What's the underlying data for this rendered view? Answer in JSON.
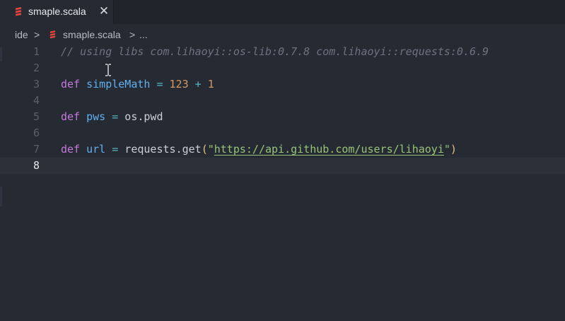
{
  "tab": {
    "title": "smaple.scala",
    "close_glyph": "✕",
    "icon": "scala-icon"
  },
  "breadcrumb": {
    "folder": "ide",
    "separator": ">",
    "file": "smaple.scala",
    "more": "..."
  },
  "editor": {
    "active_line": 8,
    "lines": [
      {
        "number": "1",
        "tokens": [
          {
            "t": "// using libs com.lihaoyi::os-lib:0.7.8 com.lihaoyi::requests:0.6.9",
            "c": "cm"
          }
        ]
      },
      {
        "number": "2",
        "tokens": []
      },
      {
        "number": "3",
        "tokens": [
          {
            "t": "def",
            "c": "kw"
          },
          {
            "t": " ",
            "c": "txt"
          },
          {
            "t": "simpleMath",
            "c": "fn"
          },
          {
            "t": " ",
            "c": "txt"
          },
          {
            "t": "=",
            "c": "op"
          },
          {
            "t": " ",
            "c": "txt"
          },
          {
            "t": "123",
            "c": "num"
          },
          {
            "t": " ",
            "c": "txt"
          },
          {
            "t": "+",
            "c": "op"
          },
          {
            "t": " ",
            "c": "txt"
          },
          {
            "t": "1",
            "c": "num"
          }
        ]
      },
      {
        "number": "4",
        "tokens": []
      },
      {
        "number": "5",
        "tokens": [
          {
            "t": "def",
            "c": "kw"
          },
          {
            "t": " ",
            "c": "txt"
          },
          {
            "t": "pws",
            "c": "fn"
          },
          {
            "t": " ",
            "c": "txt"
          },
          {
            "t": "=",
            "c": "op"
          },
          {
            "t": " os.pwd",
            "c": "txt"
          }
        ]
      },
      {
        "number": "6",
        "tokens": []
      },
      {
        "number": "7",
        "tokens": [
          {
            "t": "def",
            "c": "kw"
          },
          {
            "t": " ",
            "c": "txt"
          },
          {
            "t": "url",
            "c": "fn"
          },
          {
            "t": " ",
            "c": "txt"
          },
          {
            "t": "=",
            "c": "op"
          },
          {
            "t": " requests.get",
            "c": "txt"
          },
          {
            "t": "(",
            "c": "paren"
          },
          {
            "t": "\"",
            "c": "strq"
          },
          {
            "t": "https://api.github.com/users/lihaoyi",
            "c": "str"
          },
          {
            "t": "\"",
            "c": "strq"
          },
          {
            "t": ")",
            "c": "paren"
          }
        ]
      },
      {
        "number": "8",
        "tokens": []
      }
    ]
  },
  "colors": {
    "background": "#262b33",
    "keyword": "#c678dd",
    "function": "#61afef",
    "number": "#d19a66",
    "string": "#98c379",
    "comment": "#6b7382",
    "scala_red": "#e0443e"
  }
}
